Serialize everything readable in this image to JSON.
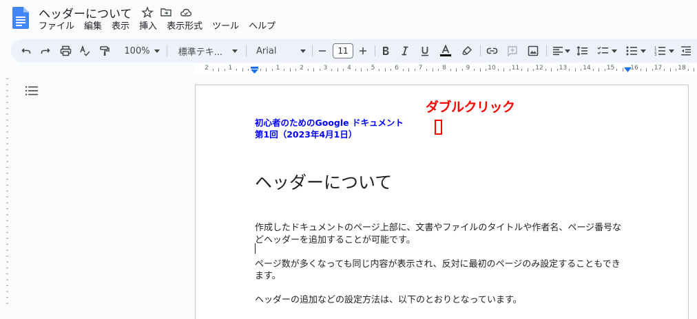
{
  "app": {
    "doc_title": "ヘッダーについて"
  },
  "menu": [
    "ファイル",
    "編集",
    "表示",
    "挿入",
    "表示形式",
    "ツール",
    "ヘルプ"
  ],
  "toolbar": {
    "zoom": "100%",
    "style": "標準テキ...",
    "font": "Arial",
    "font_size": "11",
    "icons": [
      "undo-icon",
      "redo-icon",
      "print-icon",
      "spellcheck-icon",
      "paint-format-icon",
      "bold-icon",
      "italic-icon",
      "underline-icon",
      "text-color-icon",
      "highlight-icon",
      "link-icon",
      "comment-icon",
      "image-icon",
      "align-icon",
      "line-spacing-icon",
      "checklist-icon",
      "bullet-list-icon",
      "numbered-list-icon",
      "indent-icon"
    ]
  },
  "ruler": {
    "labels": [
      "2",
      "1",
      "1",
      "2",
      "3",
      "4",
      "5",
      "6",
      "7",
      "8",
      "9",
      "10",
      "11",
      "12",
      "13",
      "14",
      "15",
      "16",
      "17",
      "18"
    ]
  },
  "page": {
    "header_lines": [
      "初心者のためのGoogle ドキュメント",
      "第1回（2023年4月1日）"
    ],
    "annotation": "ダブルクリック",
    "heading": "ヘッダーについて",
    "paragraphs": [
      "作成したドキュメントのページ上部に、文書やファイルのタイトルや作者名、ページ番号な",
      "どヘッダーを追加することが可能です。",
      "ページ数が多くなっても同じ内容が表示され、反対に最初のページのみ設定することもでき",
      "ます。",
      "ヘッダーの追加などの設定方法は、以下のとおりとなっています。"
    ]
  },
  "colors": {
    "header_text": "#0000ff",
    "annotation": "#ff0000",
    "toolbar_bg": "#edf2fa",
    "docs_blue": "#4285f4"
  }
}
